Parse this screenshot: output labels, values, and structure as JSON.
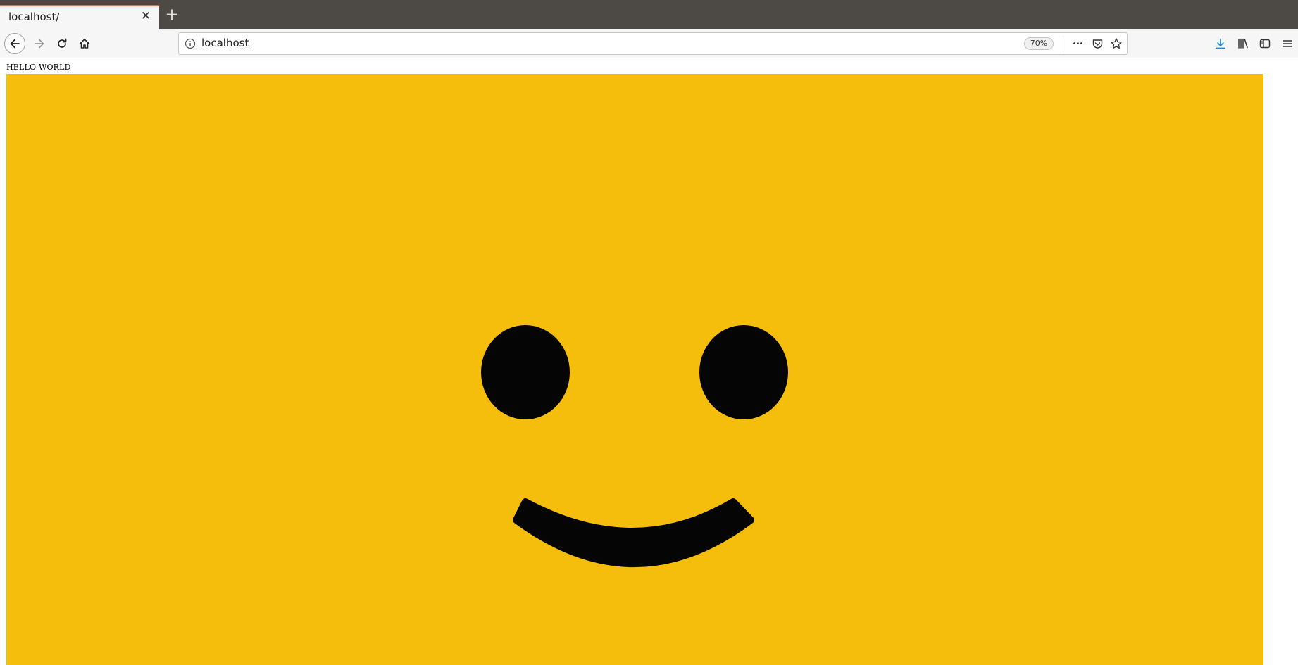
{
  "browser": {
    "tab": {
      "title": "localhost/",
      "close_glyph": "✕"
    },
    "new_tab_glyph": "+",
    "nav": {
      "back_icon": "arrow-left-icon",
      "forward_icon": "arrow-right-icon",
      "reload_icon": "reload-icon",
      "home_icon": "home-icon"
    },
    "urlbar": {
      "url": "localhost",
      "zoom": "70%",
      "page_actions_glyph": "•••"
    },
    "toolbar": {
      "downloads_icon": "download-arrow-icon",
      "library_icon": "library-icon",
      "sidebar_icon": "sidebar-icon",
      "menu_icon": "hamburger-menu-icon"
    },
    "colors": {
      "tabstrip": "#4d4a45",
      "active_tab_accent": "#e8674a",
      "download_accent": "#1a8bd8"
    }
  },
  "page": {
    "heading": "HELLO WORLD",
    "smiley": {
      "background_color": "#f5bd0c",
      "feature_color": "#050505"
    }
  }
}
